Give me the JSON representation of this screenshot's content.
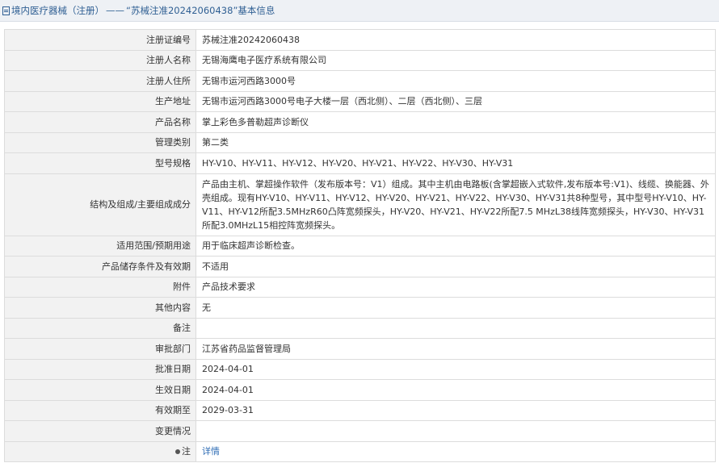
{
  "header": {
    "category": "境内医疗器械（注册）",
    "separator": "——",
    "title": "“苏械注准20242060438”基本信息"
  },
  "rows": [
    {
      "label": "注册证编号",
      "value": "苏械注准20242060438"
    },
    {
      "label": "注册人名称",
      "value": "无锡海鹰电子医疗系统有限公司"
    },
    {
      "label": "注册人住所",
      "value": "无锡市运河西路3000号"
    },
    {
      "label": "生产地址",
      "value": "无锡市运河西路3000号电子大楼一层（西北侧）、二层（西北侧）、三层"
    },
    {
      "label": "产品名称",
      "value": "掌上彩色多普勒超声诊断仪"
    },
    {
      "label": "管理类别",
      "value": "第二类"
    },
    {
      "label": "型号规格",
      "value": "HY-V10、HY-V11、HY-V12、HY-V20、HY-V21、HY-V22、HY-V30、HY-V31"
    },
    {
      "label": "结构及组成/主要组成成分",
      "value": "产品由主机、掌超操作软件（发布版本号：V1）组成。其中主机由电路板(含掌超嵌入式软件,发布版本号:V1)、线缆、换能器、外壳组成。现有HY-V10、HY-V11、HY-V12、HY-V20、HY-V21、HY-V22、HY-V30、HY-V31共8种型号，其中型号HY-V10、HY-V11、HY-V12所配3.5MHzR60凸阵宽频探头，HY-V20、HY-V21、HY-V22所配7.5 MHzL38线阵宽频探头，HY-V30、HY-V31所配3.0MHzL15相控阵宽频探头。"
    },
    {
      "label": "适用范围/预期用途",
      "value": "用于临床超声诊断检查。"
    },
    {
      "label": "产品储存条件及有效期",
      "value": "不适用"
    },
    {
      "label": "附件",
      "value": "产品技术要求"
    },
    {
      "label": "其他内容",
      "value": "无"
    },
    {
      "label": "备注",
      "value": ""
    },
    {
      "label": "审批部门",
      "value": "江苏省药品监督管理局"
    },
    {
      "label": "批准日期",
      "value": "2024-04-01"
    },
    {
      "label": "生效日期",
      "value": "2024-04-01"
    },
    {
      "label": "有效期至",
      "value": "2029-03-31"
    },
    {
      "label": "变更情况",
      "value": ""
    }
  ],
  "note_row": {
    "label": "注",
    "link": "详情"
  },
  "colors": {
    "link": "#2f6db5",
    "label_bg": "#f2f2f2",
    "header_bg": "#eef1f5",
    "header_text": "#2f5f93"
  }
}
